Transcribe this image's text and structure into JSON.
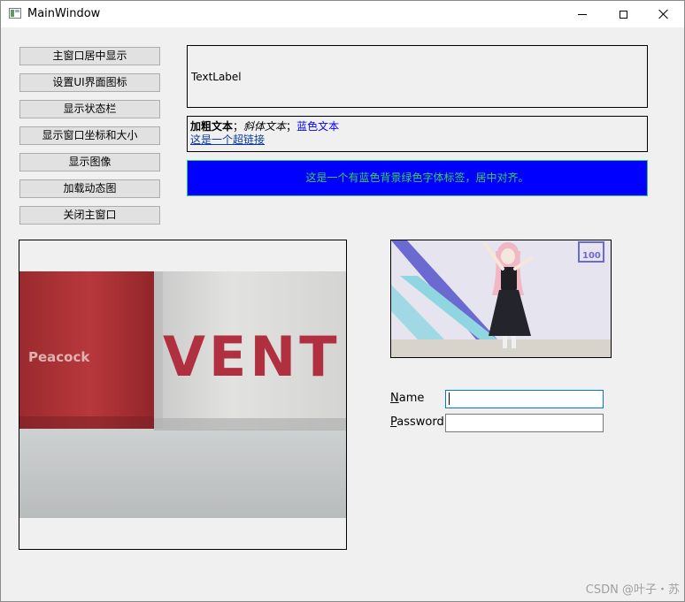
{
  "window": {
    "title": "MainWindow"
  },
  "buttons": [
    {
      "label": "主窗口居中显示"
    },
    {
      "label": "设置UI界面图标"
    },
    {
      "label": "显示状态栏"
    },
    {
      "label": "显示窗口坐标和大小"
    },
    {
      "label": "显示图像"
    },
    {
      "label": "加载动态图"
    },
    {
      "label": "关闭主窗口"
    }
  ],
  "labels": {
    "text_label": "TextLabel",
    "rich": {
      "bold": "加粗文本",
      "sep1": "；",
      "italic": "斜体文本",
      "sep2": "；",
      "blue": "蓝色文本",
      "link": "这是一个超链接"
    },
    "styled": "这是一个有蓝色背景绿色字体标签，居中对齐。"
  },
  "image": {
    "mug_text": "VENT",
    "mug_brand": "Peacock"
  },
  "gif": {
    "sign_text": "100"
  },
  "form": {
    "name_label_mnemonic": "N",
    "name_label_rest": "ame",
    "name_value": "",
    "password_label_mnemonic": "P",
    "password_label_rest": "assword",
    "password_value": ""
  },
  "watermark": "CSDN @叶子・苏",
  "colors": {
    "label_bg_blue": "#0000ff",
    "label_text_green": "#34d058",
    "rich_blue": "#0000ff"
  }
}
